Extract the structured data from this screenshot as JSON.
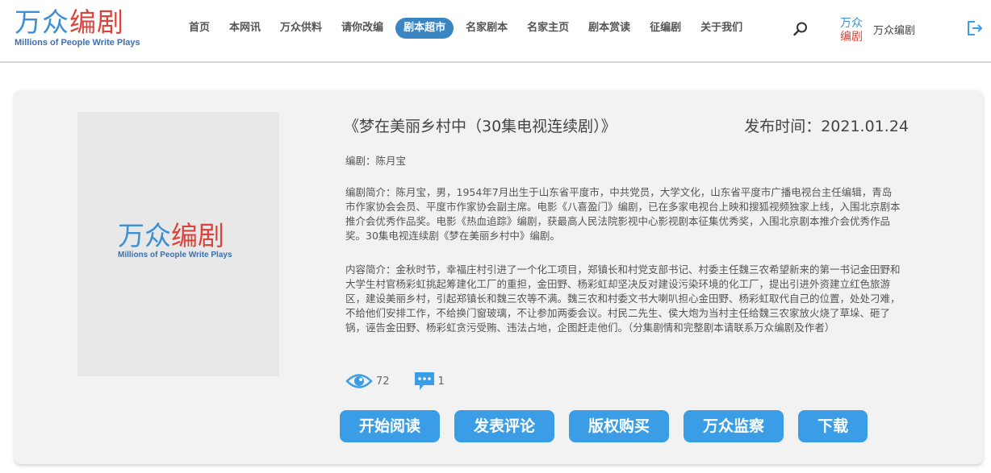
{
  "brand": {
    "logo_cn_part1": "万众",
    "logo_cn_part2": "编剧",
    "logo_en": "Millions of People Write Plays"
  },
  "nav": {
    "items": [
      {
        "label": "首页"
      },
      {
        "label": "本网讯"
      },
      {
        "label": "万众供料"
      },
      {
        "label": "请你改编"
      },
      {
        "label": "剧本超市",
        "active": true
      },
      {
        "label": "名家剧本"
      },
      {
        "label": "名家主页"
      },
      {
        "label": "剧本赏读"
      },
      {
        "label": "征编剧"
      },
      {
        "label": "关于我们"
      }
    ]
  },
  "user": {
    "name": "万众编剧"
  },
  "script": {
    "title": "《梦在美丽乡村中（30集电视连续剧）》",
    "pubdate_label": "发布时间：",
    "pubdate": "2021.01.24",
    "author_line": "编剧：陈月宝",
    "intro": "编剧简介：陈月宝，男，1954年7月出生于山东省平度市，中共党员，大学文化，山东省平度市广播电视台主任编辑，青岛市作家协会会员、平度市作家协会副主席。电影《八喜盈门》编剧，已在多家电视台上映和搜狐视频独家上线，入围北京剧本推介会优秀作品奖。电影《热血追踪》编剧，获最高人民法院影视中心影视剧本征集优秀奖，入围北京剧本推介会优秀作品奖。30集电视连续剧《梦在美丽乡村中》编剧。",
    "summary": "内容简介：金秋时节，幸福庄村引进了一个化工项目，郑镇长和村党支部书记、村委主任魏三农希望新来的第一书记金田野和大学生村官杨彩虹挑起筹建化工厂的重担，金田野、杨彩虹却坚决反对建设污染环境的化工厂，提出引进外资建立红色旅游区，建设美丽乡村，引起郑镇长和魏三农等不满。魏三农和村委文书大喇叭担心金田野、杨彩虹取代自己的位置，处处刁难，不给他们安排工作，不给换门窗玻璃，不让参加两委会议。村民二先生、侯大炮为当村主任给魏三农家放火烧了草垛、砸了锅，诬告金田野、杨彩虹贪污受贿、违法占地，企图赶走他们。（分集剧情和完整剧本请联系万众编剧及作者）",
    "views": "72",
    "comments": "1"
  },
  "actions": {
    "read": "开始阅读",
    "comment": "发表评论",
    "buy": "版权购买",
    "monitor": "万众监察",
    "download": "下载"
  },
  "colors": {
    "accent": "#3a9de6",
    "nav_active": "#3a85c2",
    "logo_blue": "#3d8fd6",
    "logo_red": "#d9453c"
  },
  "icons": {
    "search": "search-icon",
    "logout": "logout-icon",
    "views": "eye-icon",
    "comments": "comment-icon"
  }
}
